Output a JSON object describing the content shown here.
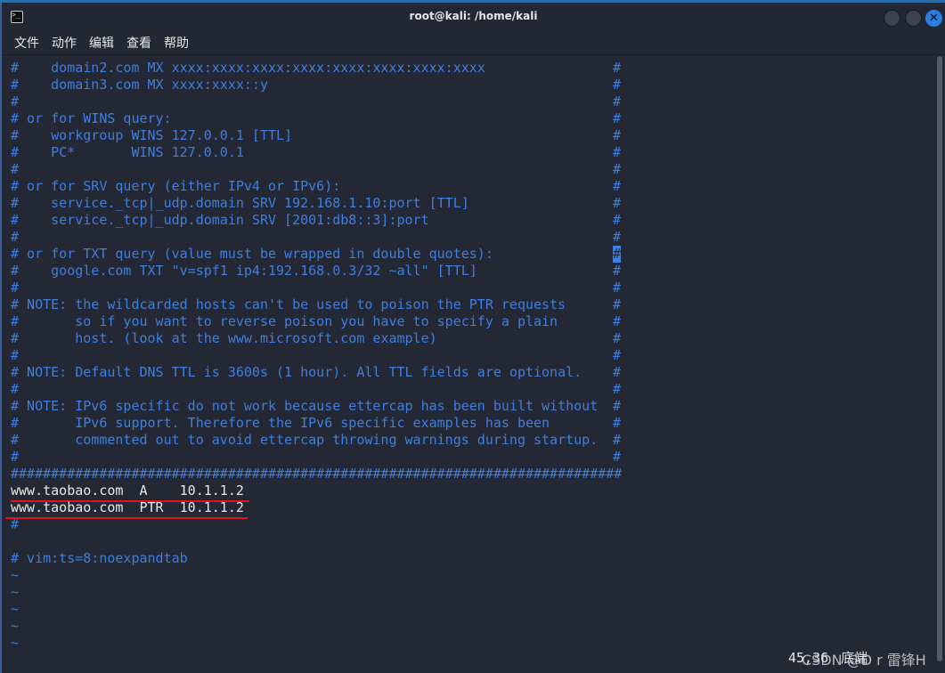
{
  "window": {
    "title": "root@kali: /home/kali"
  },
  "menu": [
    "文件",
    "动作",
    "编辑",
    "查看",
    "帮助"
  ],
  "colors": {
    "comment": "#3f7fe0",
    "text": "#e8e8e8",
    "background": "#232834",
    "underline": "#e0141c",
    "close_button": "#2a7de1"
  },
  "editor": {
    "lines": [
      {
        "text": "#    domain2.com MX xxxx:xxxx:xxxx:xxxx:xxxx:xxxx:xxxx:xxxx",
        "edge": "#"
      },
      {
        "text": "#    domain3.com MX xxxx:xxxx::y",
        "edge": "#"
      },
      {
        "text": "#",
        "edge": "#"
      },
      {
        "text": "# or for WINS query:",
        "edge": "#"
      },
      {
        "text": "#    workgroup WINS 127.0.0.1 [TTL]",
        "edge": "#"
      },
      {
        "text": "#    PC*       WINS 127.0.0.1",
        "edge": "#"
      },
      {
        "text": "#",
        "edge": "#"
      },
      {
        "text": "# or for SRV query (either IPv4 or IPv6):",
        "edge": "#"
      },
      {
        "text": "#    service._tcp|_udp.domain SRV 192.168.1.10:port [TTL]",
        "edge": "#"
      },
      {
        "text": "#    service._tcp|_udp.domain SRV [2001:db8::3]:port",
        "edge": "#"
      },
      {
        "text": "#",
        "edge": "#"
      },
      {
        "text": "# or for TXT query (value must be wrapped in double quotes):",
        "edge": "#",
        "cursor": true
      },
      {
        "text": "#    google.com TXT \"v=spf1 ip4:192.168.0.3/32 ~all\" [TTL]",
        "edge": "#"
      },
      {
        "text": "#",
        "edge": "#"
      },
      {
        "text": "# NOTE: the wildcarded hosts can't be used to poison the PTR requests",
        "edge": "#"
      },
      {
        "text": "#       so if you want to reverse poison you have to specify a plain",
        "edge": "#"
      },
      {
        "text": "#       host. (look at the www.microsoft.com example)",
        "edge": "#"
      },
      {
        "text": "#",
        "edge": "#"
      },
      {
        "text": "# NOTE: Default DNS TTL is 3600s (1 hour). All TTL fields are optional.",
        "edge": "#"
      },
      {
        "text": "#",
        "edge": "#"
      },
      {
        "text": "# NOTE: IPv6 specific do not work because ettercap has been built without",
        "edge": "#"
      },
      {
        "text": "#       IPv6 support. Therefore the IPv6 specific examples has been",
        "edge": "#"
      },
      {
        "text": "#       commented out to avoid ettercap throwing warnings during startup.",
        "edge": "#"
      },
      {
        "text": "#",
        "edge": "#"
      },
      {
        "text": "############################################################################"
      },
      {
        "text": "www.taobao.com  A    10.1.1.2",
        "plain": true,
        "underline": true
      },
      {
        "text": "www.taobao.com  PTR  10.1.1.2",
        "plain": true,
        "underline": true
      },
      {
        "text": "#"
      },
      {
        "text": ""
      },
      {
        "text": "# vim:ts=8:noexpandtab"
      },
      {
        "text": "~"
      },
      {
        "text": "~"
      },
      {
        "text": "~"
      },
      {
        "text": "~"
      },
      {
        "text": "~"
      }
    ]
  },
  "status": {
    "position": "45,36",
    "scroll": "底端"
  },
  "watermark": "CSDN @D r 雷锋H"
}
